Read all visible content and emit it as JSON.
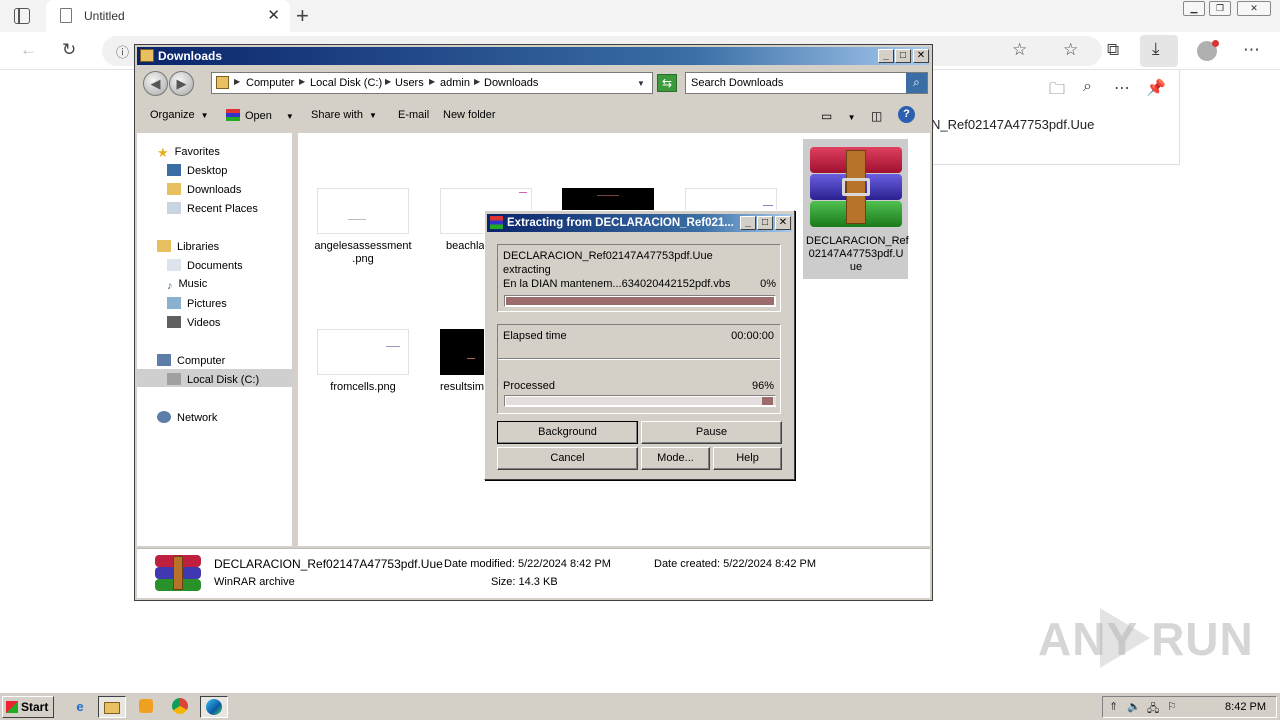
{
  "browser": {
    "tab_title": "Untitled",
    "downloads_panel_filename": "N_Ref02147A47753pdf.Uue"
  },
  "explorer": {
    "title": "Downloads",
    "breadcrumb": [
      "Computer",
      "Local Disk (C:)",
      "Users",
      "admin",
      "Downloads"
    ],
    "search_placeholder": "Search Downloads",
    "toolbar": {
      "organize": "Organize",
      "open": "Open",
      "share_with": "Share with",
      "email": "E-mail",
      "new_folder": "New folder"
    },
    "nav": {
      "favorites": "Favorites",
      "desktop": "Desktop",
      "downloads": "Downloads",
      "recent_places": "Recent Places",
      "libraries": "Libraries",
      "documents": "Documents",
      "music": "Music",
      "pictures": "Pictures",
      "videos": "Videos",
      "computer": "Computer",
      "local_disk": "Local Disk (C:)",
      "network": "Network"
    },
    "files": {
      "f1": "angelesassessment .png",
      "f2": "beachla",
      "f3": "fromcells.png",
      "f4": "resultsim",
      "selected": "DECLARACION_Ref 02147A47753pdf.U ue"
    },
    "details": {
      "name": "DECLARACION_Ref02147A47753pdf.Uue",
      "type": "WinRAR archive",
      "date_modified": "Date modified: 5/22/2024 8:42 PM",
      "date_created": "Date created: 5/22/2024 8:42 PM",
      "size": "Size: 14.3 KB"
    }
  },
  "dialog": {
    "title": "Extracting from DECLARACION_Ref021...",
    "archive": "DECLARACION_Ref02147A47753pdf.Uue",
    "status": "extracting",
    "current_file": "En la DIAN mantenem...634020442152pdf.vbs",
    "file_percent": "0%",
    "file_progress": 1.0,
    "elapsed_label": "Elapsed time",
    "elapsed_value": "00:00:00",
    "processed_label": "Processed",
    "processed_percent": "96%",
    "processed_progress": 0.96,
    "buttons": {
      "background": "Background",
      "pause": "Pause",
      "cancel": "Cancel",
      "mode": "Mode...",
      "help": "Help"
    }
  },
  "taskbar": {
    "start": "Start",
    "clock": "8:42 PM"
  },
  "watermark": "ANY RUN"
}
